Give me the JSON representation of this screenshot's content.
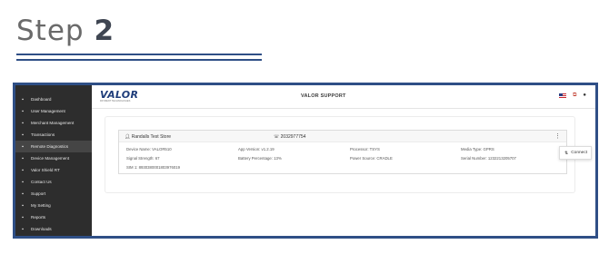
{
  "heading": {
    "step_word": "Step",
    "step_number": "2"
  },
  "app": {
    "logo_text": "VALOR",
    "logo_subtext": "PAYMENT TECHNOLOGIES",
    "header_title": "VALOR SUPPORT"
  },
  "sidebar": {
    "items": [
      {
        "label": "Dashboard",
        "icon": "grid-icon"
      },
      {
        "label": "User Management",
        "icon": "users-icon"
      },
      {
        "label": "Merchant Management",
        "icon": "store-icon"
      },
      {
        "label": "Transactions",
        "icon": "chart-icon"
      },
      {
        "label": "Remote Diagnostics",
        "icon": "monitor-icon",
        "active": true
      },
      {
        "label": "Device Management",
        "icon": "device-icon"
      },
      {
        "label": "Valor Shield RT",
        "icon": "shield-icon"
      },
      {
        "label": "Contact Us",
        "icon": "contact-icon"
      },
      {
        "label": "Support",
        "icon": "support-icon"
      },
      {
        "label": "My Setting",
        "icon": "settings-icon"
      },
      {
        "label": "Reports",
        "icon": "reports-icon"
      },
      {
        "label": "Downloads",
        "icon": "download-icon"
      }
    ]
  },
  "device_card": {
    "store_name": "Randalls Test Store",
    "phone": "2032977754",
    "device_name": "Device Name: VALOR510",
    "app_version": "App Version: v1.2.19",
    "processor": "Processor: TSYS",
    "media_type": "Media Type: GPRS",
    "signal_strength": "Signal Strength: 67",
    "battery_percentage": "Battery Percentage: 13%",
    "power_source": "Power Source: CRADLE",
    "serial_number": "Serial Number: 1232213205707",
    "sim": "SIM 1: 8930380001803976019"
  },
  "popup": {
    "connect_label": "Connect"
  },
  "colors": {
    "brand_blue": "#2f4f86",
    "sidebar_bg": "#2d2d2d"
  }
}
